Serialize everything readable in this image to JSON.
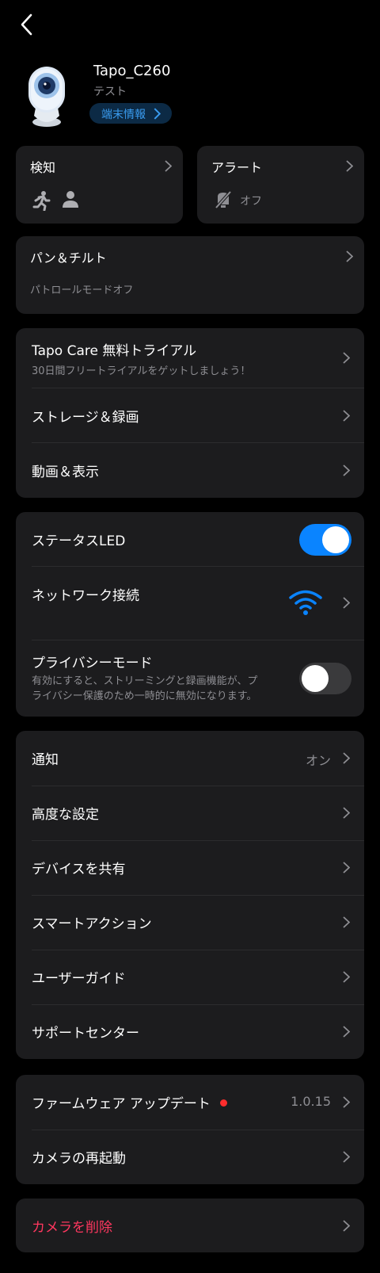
{
  "header": {
    "device_name": "Tapo_C260",
    "device_sub": "テスト",
    "info_button": "端末情報"
  },
  "tiles": {
    "detection": {
      "title": "検知"
    },
    "alert": {
      "title": "アラート",
      "status": "オフ"
    },
    "pan_tilt": {
      "title": "パン＆チルト",
      "sub": "パトロールモードオフ"
    }
  },
  "group1": {
    "care_title": "Tapo Care 無料トライアル",
    "care_sub": "30日間フリートライアルをゲットしましょう！",
    "storage": "ストレージ＆録画",
    "video": "動画＆表示"
  },
  "group2": {
    "status_led": "ステータスLED",
    "status_led_on": true,
    "network": "ネットワーク接続",
    "privacy": "プライバシーモード",
    "privacy_desc_1": "有効にすると、ストリーミングと録画機能が、プ",
    "privacy_desc_2": "ライバシー保護のため一時的に無効になります。",
    "privacy_on": false
  },
  "group3": {
    "notify": "通知",
    "notify_value": "オン",
    "advanced": "高度な設定",
    "share": "デバイスを共有",
    "smart": "スマートアクション",
    "guide": "ユーザーガイド",
    "support": "サポートセンター"
  },
  "group4": {
    "firmware": "ファームウェア アップデート",
    "firmware_version": "1.0.15",
    "reboot": "カメラの再起動"
  },
  "group5": {
    "delete": "カメラを削除"
  },
  "colors": {
    "accent": "#0a84ff",
    "danger": "#ff375f",
    "card": "#1c1c1e"
  }
}
